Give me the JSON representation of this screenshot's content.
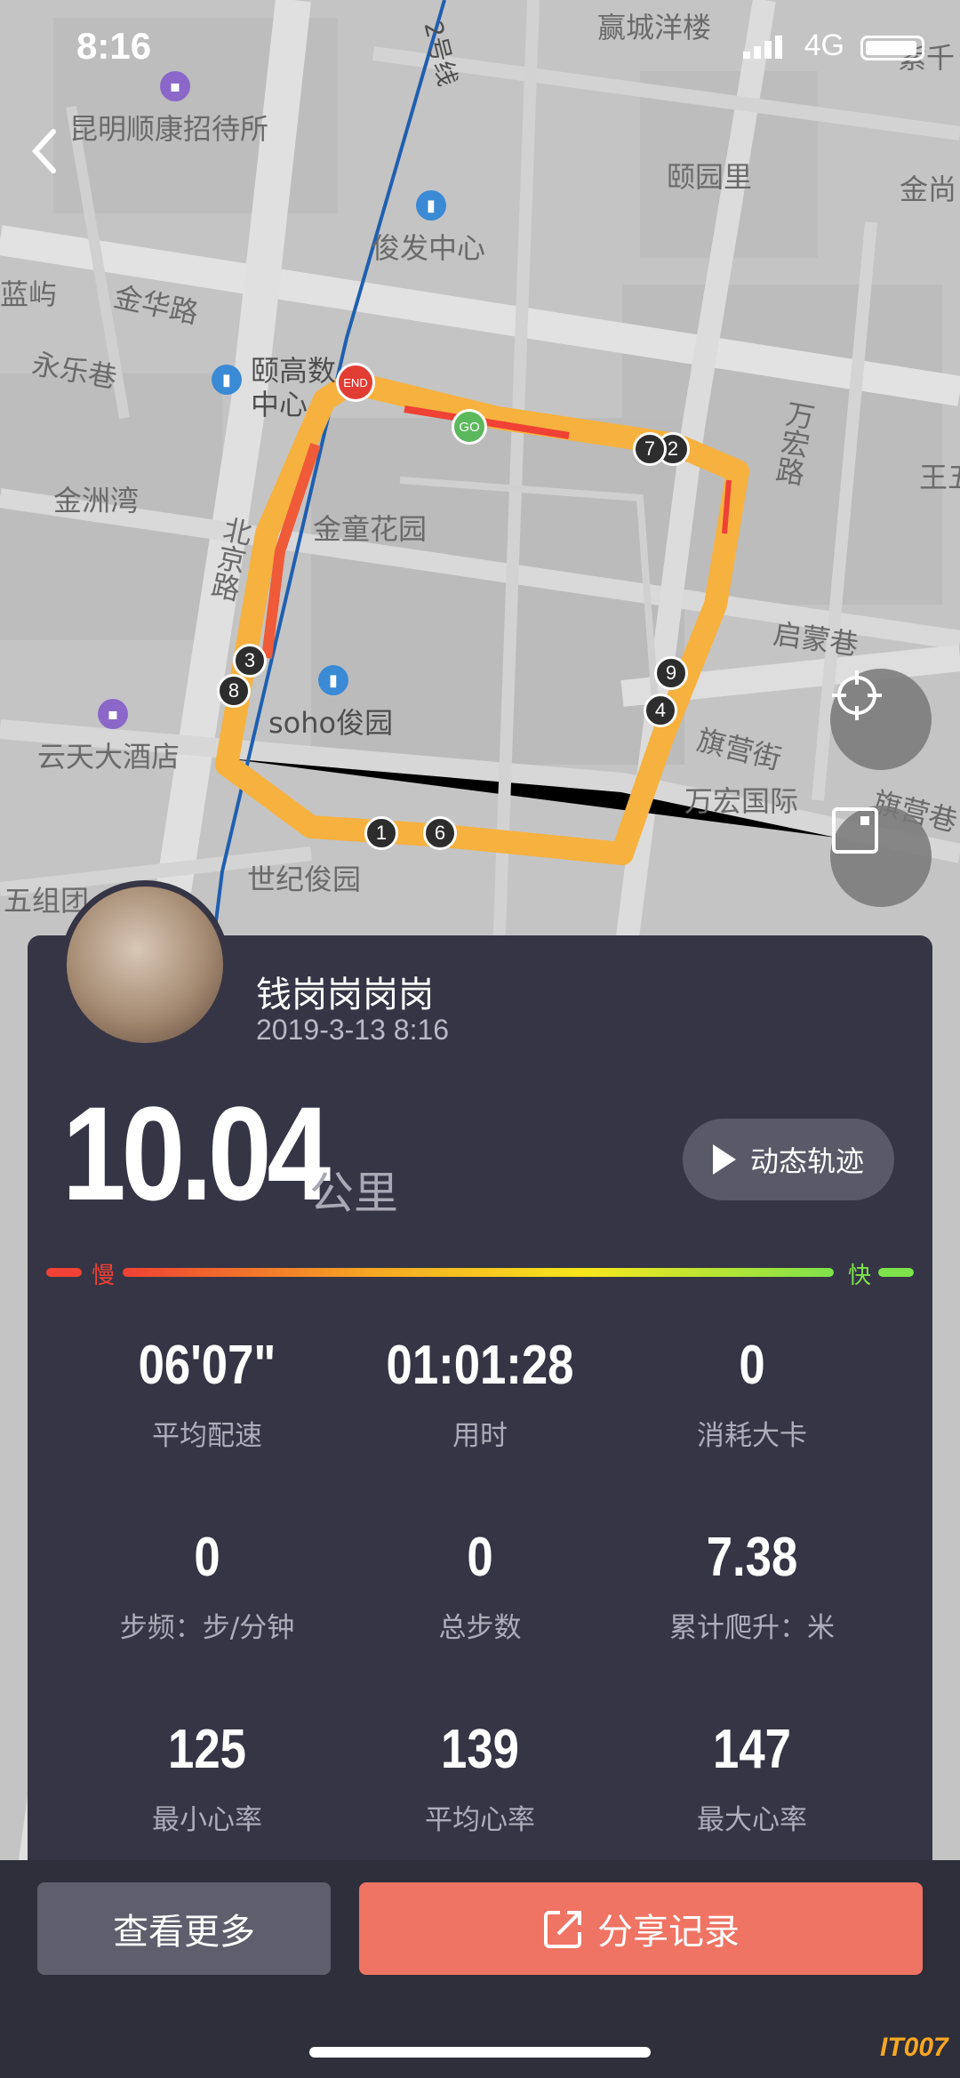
{
  "status_bar": {
    "time": "8:16",
    "network": "4G"
  },
  "map": {
    "labels": {
      "l1": "昆明顺康招待所",
      "l2": "赢城洋楼",
      "l3": "颐园里",
      "l4": "金尚",
      "l5": "俊发中心",
      "l6": "金华路",
      "l7": "永乐巷",
      "l8": "颐高数",
      "l9": "中心",
      "l10": "金洲湾",
      "l11": "金童花园",
      "l12": "北京路",
      "l13": "万宏路",
      "l14": "王五",
      "l15": "启蒙巷",
      "l16": "soho俊园",
      "l17": "云天大酒店",
      "l18": "旗营街",
      "l19": "万宏国际",
      "l20": "旗营巷",
      "l21": "世纪俊园",
      "l22": "五组团",
      "l23": "2号线",
      "l24": "紫千",
      "l25": "蓝屿"
    },
    "markers": {
      "end": "END",
      "go": "GO",
      "m1": "1",
      "m2": "2",
      "m3": "3",
      "m4": "4",
      "m6": "6",
      "m7": "7",
      "m8": "8",
      "m9": "9"
    }
  },
  "user": {
    "name": "钱岗岗岗岗",
    "date": "2019-3-13 8:16"
  },
  "summary": {
    "distance": "10.04",
    "unit": "公里",
    "replay_label": "动态轨迹"
  },
  "speed_legend": {
    "slow": "慢",
    "fast": "快",
    "colors": [
      "#ef4134",
      "#f5a623",
      "#f8e71c",
      "#7ee24a"
    ]
  },
  "stats": [
    {
      "value": "06'07\"",
      "label": "平均配速"
    },
    {
      "value": "01:01:28",
      "label": "用时"
    },
    {
      "value": "0",
      "label": "消耗大卡"
    },
    {
      "value": "0",
      "label": "步频：步/分钟"
    },
    {
      "value": "0",
      "label": "总步数"
    },
    {
      "value": "7.38",
      "label": "累计爬升：米"
    },
    {
      "value": "125",
      "label": "最小心率"
    },
    {
      "value": "139",
      "label": "平均心率"
    },
    {
      "value": "147",
      "label": "最大心率"
    }
  ],
  "buttons": {
    "more": "查看更多",
    "share": "分享记录"
  },
  "watermark": "IT007"
}
